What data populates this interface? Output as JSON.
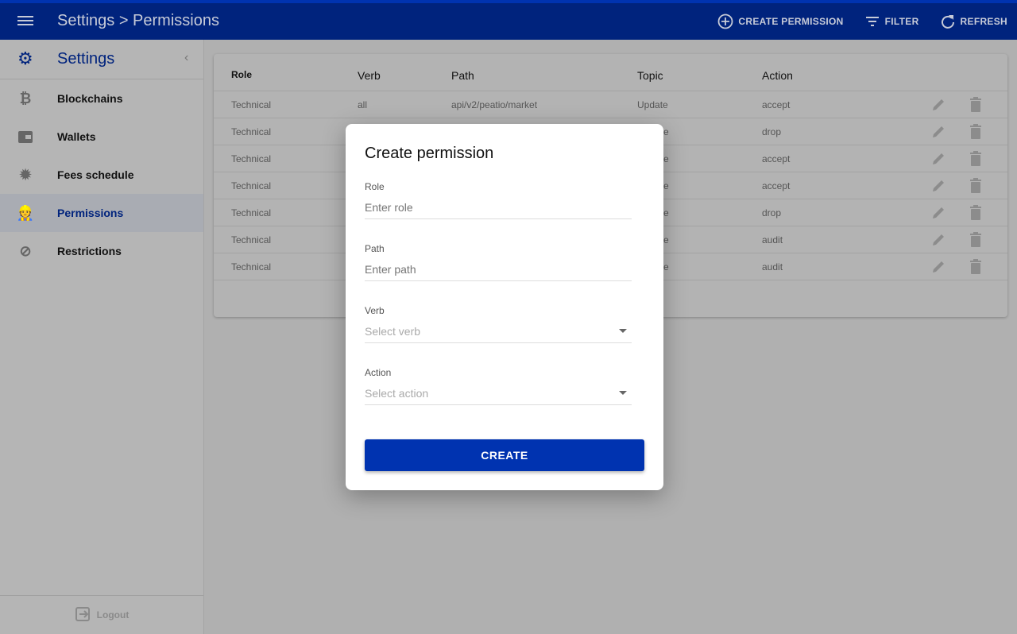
{
  "header": {
    "title": "Settings > Permissions",
    "actions": [
      {
        "label": "CREATE PERMISSION",
        "icon": "plus-circle-icon"
      },
      {
        "label": "FILTER",
        "icon": "filter-icon"
      },
      {
        "label": "REFRESH",
        "icon": "refresh-icon"
      }
    ]
  },
  "sidebar": {
    "title": "Settings",
    "items": [
      {
        "label": "Blockchains",
        "icon": "bitcoin-icon"
      },
      {
        "label": "Wallets",
        "icon": "wallet-icon"
      },
      {
        "label": "Fees schedule",
        "icon": "percent-badge-icon"
      },
      {
        "label": "Permissions",
        "icon": "worker-icon",
        "active": true
      },
      {
        "label": "Restrictions",
        "icon": "block-icon"
      }
    ],
    "logout": "Logout"
  },
  "table": {
    "headers": [
      "Role",
      "Verb",
      "Path",
      "Topic",
      "Action"
    ],
    "rows": [
      {
        "role": "Technical",
        "verb": "all",
        "path": "api/v2/peatio/market",
        "topic": "Update",
        "action": "accept"
      },
      {
        "role": "Technical",
        "verb": "",
        "path": "",
        "topic": "e",
        "action": "drop"
      },
      {
        "role": "Technical",
        "verb": "",
        "path": "",
        "topic": "e",
        "action": "accept"
      },
      {
        "role": "Technical",
        "verb": "",
        "path": "",
        "topic": "e",
        "action": "accept"
      },
      {
        "role": "Technical",
        "verb": "",
        "path": "",
        "topic": "e",
        "action": "drop"
      },
      {
        "role": "Technical",
        "verb": "",
        "path": "",
        "topic": "e",
        "action": "audit"
      },
      {
        "role": "Technical",
        "verb": "",
        "path": "",
        "topic": "e",
        "action": "audit"
      }
    ]
  },
  "modal": {
    "title": "Create permission",
    "fields": [
      {
        "label": "Role",
        "placeholder": "Enter role"
      },
      {
        "label": "Path",
        "placeholder": "Enter path"
      },
      {
        "label": "Verb",
        "placeholder": "Select verb"
      },
      {
        "label": "Action",
        "placeholder": "Select action"
      }
    ],
    "submit": "CREATE"
  },
  "colors": {
    "header": "#00237d",
    "accent": "#0033b0"
  }
}
